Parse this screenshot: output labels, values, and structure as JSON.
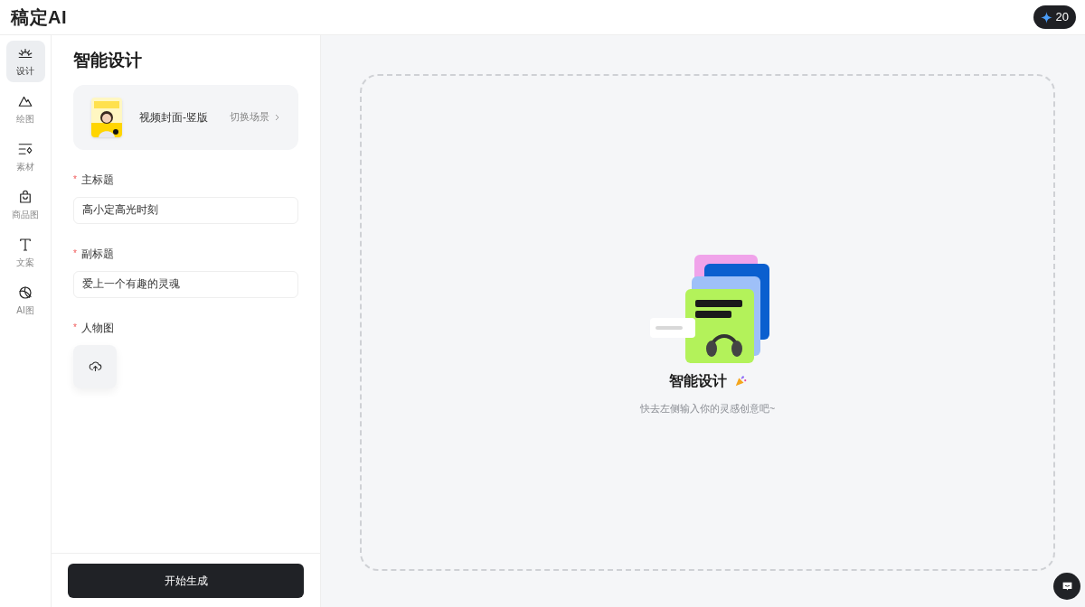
{
  "header": {
    "logo": "稿定AI",
    "credits": "20"
  },
  "nav": [
    {
      "label": "设计",
      "selected": true
    },
    {
      "label": "绘图",
      "selected": false
    },
    {
      "label": "素材",
      "selected": false
    },
    {
      "label": "商品图",
      "selected": false
    },
    {
      "label": "文案",
      "selected": false
    },
    {
      "label": "AI图",
      "selected": false
    }
  ],
  "panel": {
    "title": "智能设计",
    "scene": {
      "name": "视频封面-竖版",
      "switch": "切换场景"
    },
    "fields": [
      {
        "label": "主标题",
        "mark": "*",
        "kind": "text",
        "value": "高小定高光时刻"
      },
      {
        "label": "副标题",
        "mark": "*",
        "kind": "text",
        "value": "爱上一个有趣的灵魂"
      },
      {
        "label": "人物图",
        "mark": "*",
        "kind": "upload"
      }
    ],
    "submit": "开始生成"
  },
  "canvas": {
    "title": "智能设计",
    "hint": "快去左侧输入你的灵感创意吧~"
  }
}
